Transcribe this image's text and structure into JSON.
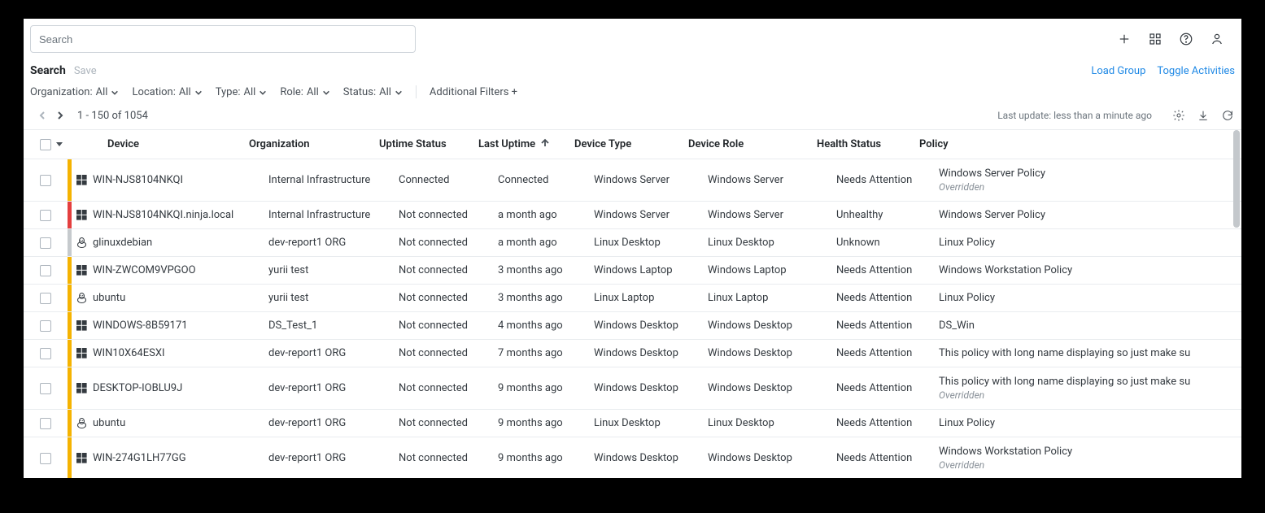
{
  "search": {
    "placeholder": "Search"
  },
  "header": {
    "title": "Search",
    "save": "Save",
    "load_group": "Load Group",
    "toggle_activities": "Toggle Activities"
  },
  "filters": {
    "organization": {
      "label": "Organization:",
      "value": "All"
    },
    "location": {
      "label": "Location:",
      "value": "All"
    },
    "type": {
      "label": "Type:",
      "value": "All"
    },
    "role": {
      "label": "Role:",
      "value": "All"
    },
    "status": {
      "label": "Status:",
      "value": "All"
    },
    "additional": "Additional Filters +"
  },
  "pagination": {
    "range": "1 - 150 of 1054",
    "last_update": "Last update: less than a minute ago"
  },
  "columns": {
    "device": "Device",
    "organization": "Organization",
    "uptime": "Uptime Status",
    "last_uptime": "Last Uptime",
    "type": "Device Type",
    "role": "Device Role",
    "health": "Health Status",
    "policy": "Policy"
  },
  "overridden_label": "Overridden",
  "rows": [
    {
      "status": "yellow",
      "os": "windows",
      "device": "WIN-NJS8104NKQI",
      "org": "Internal Infrastructure",
      "uptime": "Connected",
      "last": "Connected",
      "type": "Windows Server",
      "role": "Windows Server",
      "health": "Needs Attention",
      "policy": "Windows Server Policy",
      "overridden": true
    },
    {
      "status": "red",
      "os": "windows",
      "device": "WIN-NJS8104NKQI.ninja.local",
      "org": "Internal Infrastructure",
      "uptime": "Not connected",
      "last": "a month ago",
      "type": "Windows Server",
      "role": "Windows Server",
      "health": "Unhealthy",
      "policy": "Windows Server Policy",
      "overridden": false
    },
    {
      "status": "gray",
      "os": "linux",
      "device": "glinuxdebian",
      "org": "dev-report1 ORG",
      "uptime": "Not connected",
      "last": "a month ago",
      "type": "Linux Desktop",
      "role": "Linux Desktop",
      "health": "Unknown",
      "policy": "Linux Policy",
      "overridden": false
    },
    {
      "status": "yellow",
      "os": "windows",
      "device": "WIN-ZWCOM9VPGOO",
      "org": "yurii test",
      "uptime": "Not connected",
      "last": "3 months ago",
      "type": "Windows Laptop",
      "role": "Windows Laptop",
      "health": "Needs Attention",
      "policy": "Windows Workstation Policy",
      "overridden": false
    },
    {
      "status": "yellow",
      "os": "linux",
      "device": "ubuntu",
      "org": "yurii test",
      "uptime": "Not connected",
      "last": "3 months ago",
      "type": "Linux Laptop",
      "role": "Linux Laptop",
      "health": "Needs Attention",
      "policy": "Linux Policy",
      "overridden": false
    },
    {
      "status": "yellow",
      "os": "windows",
      "device": "WINDOWS-8B59171",
      "org": "DS_Test_1",
      "uptime": "Not connected",
      "last": "4 months ago",
      "type": "Windows Desktop",
      "role": "Windows Desktop",
      "health": "Needs Attention",
      "policy": "DS_Win",
      "overridden": false
    },
    {
      "status": "yellow",
      "os": "windows",
      "device": "WIN10X64ESXI",
      "org": "dev-report1 ORG",
      "uptime": "Not connected",
      "last": "7 months ago",
      "type": "Windows Desktop",
      "role": "Windows Desktop",
      "health": "Needs Attention",
      "policy": "This policy with long name displaying so just make su",
      "overridden": false
    },
    {
      "status": "yellow",
      "os": "windows",
      "device": "DESKTOP-IOBLU9J",
      "org": "dev-report1 ORG",
      "uptime": "Not connected",
      "last": "9 months ago",
      "type": "Windows Desktop",
      "role": "Windows Desktop",
      "health": "Needs Attention",
      "policy": "This policy with long name displaying so just make su",
      "overridden": true
    },
    {
      "status": "yellow",
      "os": "linux",
      "device": "ubuntu",
      "org": "dev-report1 ORG",
      "uptime": "Not connected",
      "last": "9 months ago",
      "type": "Linux Desktop",
      "role": "Linux Desktop",
      "health": "Needs Attention",
      "policy": "Linux Policy",
      "overridden": false
    },
    {
      "status": "yellow",
      "os": "windows",
      "device": "WIN-274G1LH77GG",
      "org": "dev-report1 ORG",
      "uptime": "Not connected",
      "last": "9 months ago",
      "type": "Windows Desktop",
      "role": "Windows Desktop",
      "health": "Needs Attention",
      "policy": "Windows Workstation Policy",
      "overridden": true
    }
  ]
}
